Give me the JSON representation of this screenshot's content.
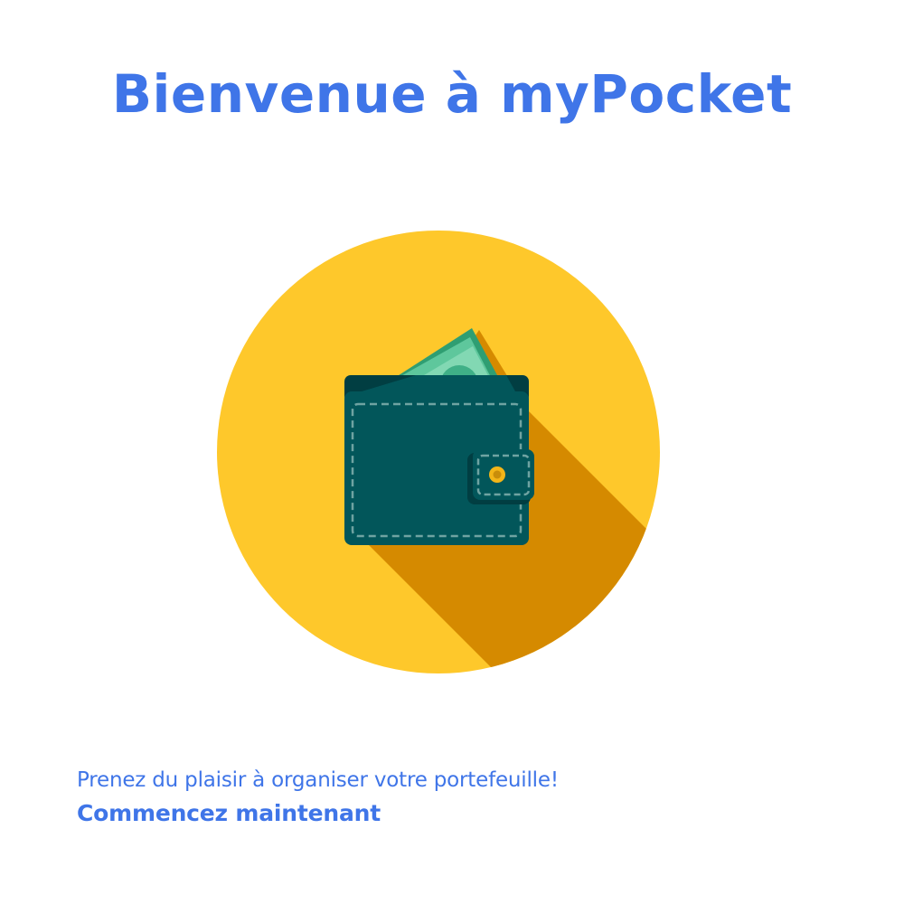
{
  "welcome": {
    "title": "Bienvenue à myPocket",
    "tagline": "Prenez du plaisir à organiser votre portefeuille!",
    "cta_label": "Commencez maintenant"
  },
  "illustration": {
    "icon": "wallet-with-cash-icon"
  },
  "colors": {
    "accent": "#3f75e8",
    "circle": "#fec82b",
    "shadow": "#d58a00",
    "wallet": "#02565a",
    "wallet_dark": "#013e42",
    "cash": "#5ec79c",
    "cash_dark": "#2f9e72",
    "clasp": "#f3b518",
    "background": "#ffffff"
  }
}
